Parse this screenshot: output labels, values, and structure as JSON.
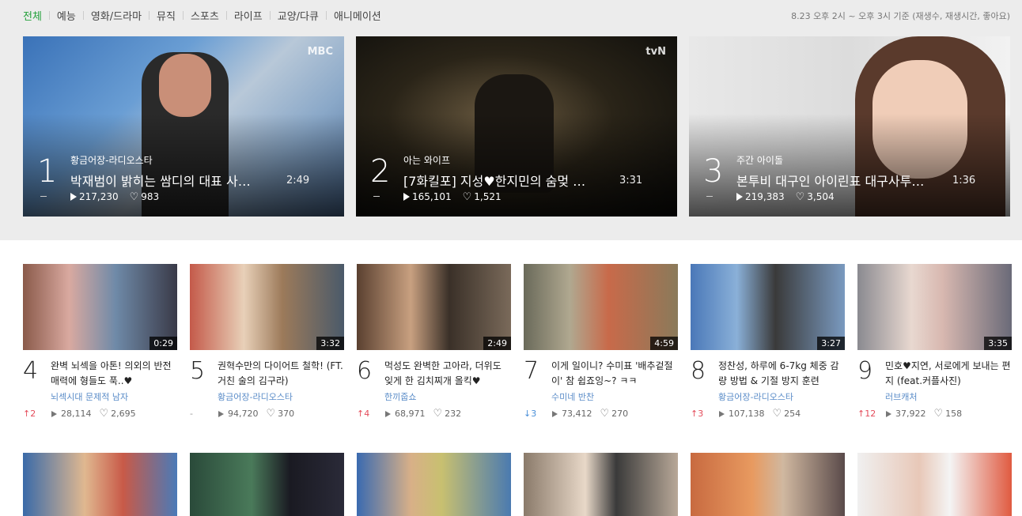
{
  "nav": {
    "categories": [
      "전체",
      "예능",
      "영화/드라마",
      "뮤직",
      "스포츠",
      "라이프",
      "교양/다큐",
      "애니메이션"
    ],
    "basis": "8.23 오후 2시 ~ 오후 3시 기준 (재생수, 재생시간, 좋아요)"
  },
  "heroes": [
    {
      "rank": "1",
      "program": "황금어장-라디오스타",
      "title": "박재범이 밝히는 쌈디의 대표 사…",
      "duration": "2:49",
      "plays": "217,230",
      "likes": "983",
      "brand": "MBC"
    },
    {
      "rank": "2",
      "program": "아는 와이프",
      "title": "[7화킬포] 지성♥한지민의 숨멎 …",
      "duration": "3:31",
      "plays": "165,101",
      "likes": "1,521",
      "brand": "tvN"
    },
    {
      "rank": "3",
      "program": "주간 아이돌",
      "title": "본투비 대구인 아이린표 대구사투…",
      "duration": "1:36",
      "plays": "219,383",
      "likes": "3,504",
      "brand": ""
    }
  ],
  "cards": [
    {
      "rank": "4",
      "title": "완벽 뇌섹을 아톤! 의외의 반전 매력에 형들도 푹..♥",
      "program": "뇌섹시대 문제적 남자",
      "duration": "0:29",
      "change": "↑2",
      "trend": "up",
      "plays": "28,114",
      "likes": "2,695"
    },
    {
      "rank": "5",
      "title": "권혁수만의 다이어트 철학! (FT. 거친 술의 김구라)",
      "program": "황금어장-라디오스타",
      "duration": "3:32",
      "change": "-",
      "trend": "same",
      "plays": "94,720",
      "likes": "370"
    },
    {
      "rank": "6",
      "title": "먹성도 완벽한 고아라, 더위도 잊게 한 김치찌개 올킥♥",
      "program": "한끼줍쇼",
      "duration": "2:49",
      "change": "↑4",
      "trend": "up",
      "plays": "68,971",
      "likes": "232"
    },
    {
      "rank": "7",
      "title": "이게 일이니? 수미표 '배추겉절이' 참 쉽죠잉~? ㅋㅋ",
      "program": "수미네 반찬",
      "duration": "4:59",
      "change": "↓3",
      "trend": "down",
      "plays": "73,412",
      "likes": "270"
    },
    {
      "rank": "8",
      "title": "정찬성, 하루에 6-7kg 체중 감량 방법 & 기절 방지 훈련",
      "program": "황금어장-라디오스타",
      "duration": "3:27",
      "change": "↑3",
      "trend": "up",
      "plays": "107,138",
      "likes": "254"
    },
    {
      "rank": "9",
      "title": "민호♥지연, 서로에게 보내는 편지 (feat.커플사진)",
      "program": "러브캐처",
      "duration": "3:35",
      "change": "↑12",
      "trend": "up",
      "plays": "37,922",
      "likes": "158"
    }
  ]
}
